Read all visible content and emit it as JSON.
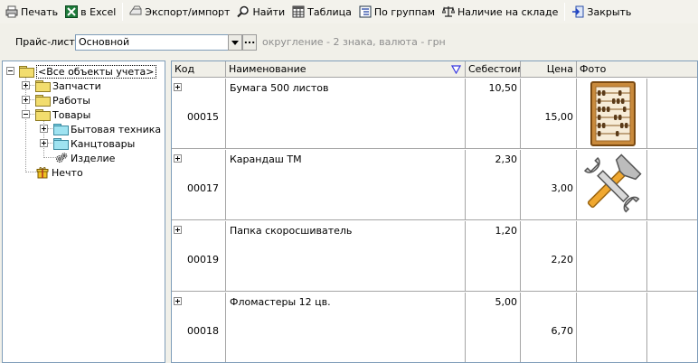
{
  "toolbar": {
    "print_label": "Печать",
    "excel_label": "в Excel",
    "export_label": "Экспорт/импорт",
    "find_label": "Найти",
    "table_label": "Таблица",
    "groups_label": "По группам",
    "stock_label": "Наличие на складе",
    "close_label": "Закрыть"
  },
  "pricelist": {
    "label": "Прайс-лист",
    "selected": "Основной",
    "more_label": "...",
    "note": "округление - 2 знака, валюта - грн"
  },
  "tree": {
    "root": "<Все объекты учета>",
    "items": [
      "Запчасти",
      "Работы",
      "Товары",
      "Бытовая техника",
      "Канцтовары",
      "Изделие",
      "Нечто"
    ]
  },
  "grid": {
    "columns": [
      "Код",
      "Наименование",
      "Себестоим",
      "Цена",
      "Фото"
    ],
    "rows": [
      {
        "code": "00015",
        "name": "Бумага 500 листов",
        "cost": "10,50",
        "price": "15,00",
        "photo": "abacus-icon"
      },
      {
        "code": "00017",
        "name": "Карандаш ТМ",
        "cost": "2,30",
        "price": "3,00",
        "photo": "tools-icon"
      },
      {
        "code": "00019",
        "name": "Папка скоросшиватель",
        "cost": "1,20",
        "price": "2,20",
        "photo": ""
      },
      {
        "code": "00018",
        "name": "Фломастеры 12 цв.",
        "cost": "5,00",
        "price": "6,70",
        "photo": ""
      }
    ]
  },
  "colors": {
    "background": "#f1f0e9",
    "border": "#7f9db9",
    "note_text": "#8d8d8d",
    "sort_arrow": "#3a3ae0"
  }
}
